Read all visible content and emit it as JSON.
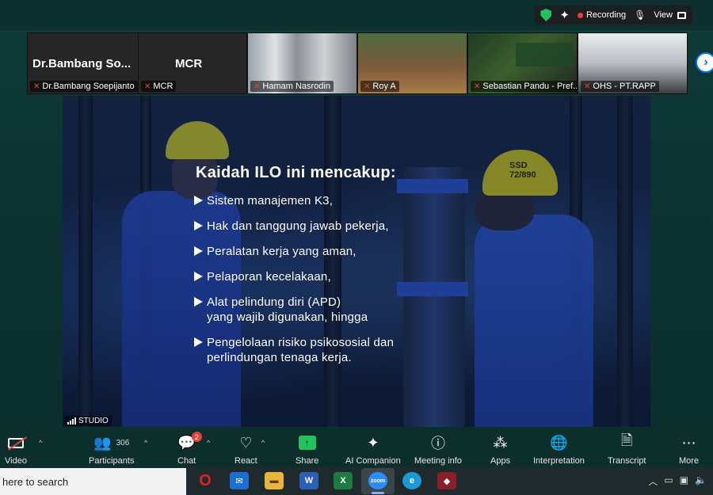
{
  "topbar": {
    "recording_label": "Recording",
    "view_label": "View",
    "icons": [
      "shield-check-icon",
      "sparkle-icon",
      "mic-icon",
      "grid-view-icon"
    ]
  },
  "participants": [
    {
      "display_name": "Dr.Bambang  So...",
      "label": "Dr.Bambang Soepijanto",
      "muted": true
    },
    {
      "display_name": "MCR",
      "label": "MCR",
      "muted": true
    },
    {
      "display_name": "",
      "label": "Hamam Nasrodin",
      "muted": true
    },
    {
      "display_name": "",
      "label": "Roy A",
      "muted": true
    },
    {
      "display_name": "",
      "label": "Sebastian Pandu - Pref...",
      "muted": true
    },
    {
      "display_name": "",
      "label": "OHS - PT.RAPP",
      "muted": true
    }
  ],
  "slide": {
    "title": "Kaidah ILO ini mencakup:",
    "bullets": [
      "Sistem manajemen K3,",
      "Hak dan tanggung jawab pekerja,",
      "Peralatan kerja yang aman,",
      "Pelaporan kecelakaan,",
      "Alat pelindung diri (APD)\nyang wajib digunakan, hingga",
      "Pengelolaan risiko psikososial dan\nperlindungan tenaga kerja."
    ],
    "helmet_text": "SSD\n72/890",
    "studio_label": "STUDIO"
  },
  "toolbar": {
    "video": "Video",
    "participants": "Participants",
    "participants_count": "306",
    "chat": "Chat",
    "chat_badge": "2",
    "react": "React",
    "share": "Share",
    "ai_companion": "AI Companion",
    "meeting_info": "Meeting info",
    "apps": "Apps",
    "interpretation": "Interpretation",
    "transcript": "Transcript",
    "more": "More"
  },
  "taskbar": {
    "search_text": "here to search",
    "apps": [
      "opera-icon",
      "mail-icon",
      "file-explorer-icon",
      "word-icon",
      "excel-icon",
      "zoom-icon",
      "edge-icon",
      "app-icon"
    ]
  },
  "colors": {
    "accent_green": "#22c35e",
    "mute_red": "#e8413b",
    "background": "#0c302d"
  }
}
